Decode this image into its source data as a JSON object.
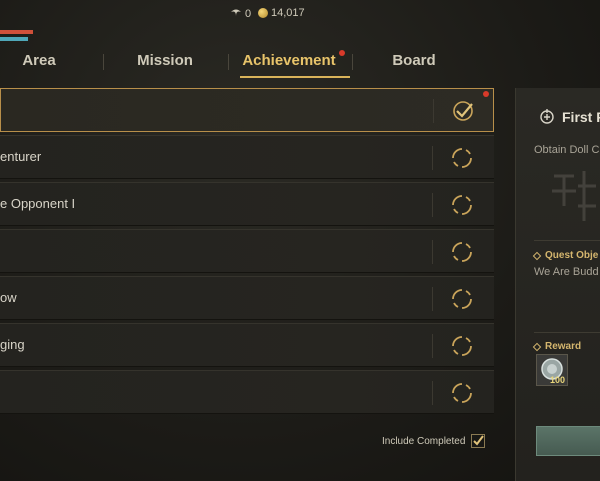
{
  "header": {
    "currency_a": {
      "icon": "wing-icon",
      "value": "0"
    },
    "currency_b": {
      "icon": "gold-coin-icon",
      "value": "14,017"
    }
  },
  "tabs": [
    {
      "label": "Area",
      "active": false
    },
    {
      "label": "Mission",
      "active": false
    },
    {
      "label": "Achievement",
      "active": true,
      "notification": true
    },
    {
      "label": "Board",
      "active": false
    }
  ],
  "achievements": [
    {
      "label": "",
      "status": "completed",
      "selected": true,
      "notification": true
    },
    {
      "label": "enturer",
      "status": "in-progress"
    },
    {
      "label": "e Opponent I",
      "status": "in-progress"
    },
    {
      "label": "",
      "status": "in-progress"
    },
    {
      "label": "ow",
      "status": "in-progress"
    },
    {
      "label": "ging",
      "status": "in-progress"
    },
    {
      "label": "",
      "status": "in-progress"
    }
  ],
  "filter": {
    "include_completed_label": "Include Completed",
    "checked": true
  },
  "detail": {
    "title": "First F",
    "title_icon": "quest-scroll-icon",
    "description": "Obtain Doll C",
    "objective_heading": "Quest Obje",
    "objective_text": "We Are Budd",
    "reward_heading": "Reward",
    "reward_item_icon": "silver-coin-icon",
    "reward_count": "100"
  },
  "colors": {
    "accent_gold": "#e8c46a",
    "notification_red": "#d83a2a",
    "logo_red": "#d0503a",
    "logo_teal": "#4fa7b8"
  }
}
